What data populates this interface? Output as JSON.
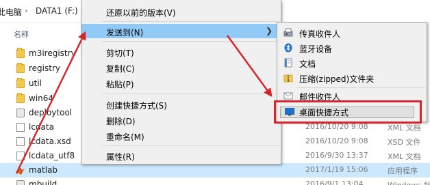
{
  "address": {
    "segment1": "此电脑",
    "segment2": "DATA1 (F:)"
  },
  "columns": {
    "name": "名称"
  },
  "files": [
    {
      "name": "m3iregistry",
      "kind": "folder",
      "date": "",
      "type": ""
    },
    {
      "name": "registry",
      "kind": "folder",
      "date": "",
      "type": ""
    },
    {
      "name": "util",
      "kind": "folder",
      "date": "",
      "type": ""
    },
    {
      "name": "win64",
      "kind": "folder",
      "date": "",
      "type": ""
    },
    {
      "name": "deploytool",
      "kind": "gear",
      "date": "",
      "type": ""
    },
    {
      "name": "lcdata",
      "kind": "file",
      "date": "2016/10/20 9:08",
      "type": "XML 文档"
    },
    {
      "name": "lcdata.xsd",
      "kind": "file",
      "date": "2016/10/20 9:08",
      "type": "XSD 文件"
    },
    {
      "name": "lcdata_utf8",
      "kind": "file",
      "date": "2016/9/30 13:37",
      "type": "XML 文档"
    },
    {
      "name": "matlab",
      "kind": "matlab",
      "date": "2017/1/19 15:06",
      "type": "应用程序",
      "selected": true
    },
    {
      "name": "mbuild",
      "kind": "file",
      "date": "2016/9/1 13:04",
      "type": "Windows 批"
    }
  ],
  "context_menu": {
    "restore_previous": "还原以前的版本(V)",
    "send_to": "发送到(N)",
    "cut": "剪切(T)",
    "copy": "复制(C)",
    "paste": "粘贴(P)",
    "create_shortcut": "创建快捷方式(S)",
    "delete": "删除(D)",
    "rename": "重命名(M)",
    "properties": "属性(R)"
  },
  "submenu": {
    "fax": "传真收件人",
    "bluetooth": "蓝牙设备",
    "documents": "文档",
    "zip": "压缩(zipped)文件夹",
    "mail": "邮件收件人",
    "desktop": "桌面快捷方式"
  },
  "colors": {
    "annotation_red": "#d6252c",
    "menu_highlight": "#91c9f7",
    "row_selected": "#cce8ff"
  }
}
